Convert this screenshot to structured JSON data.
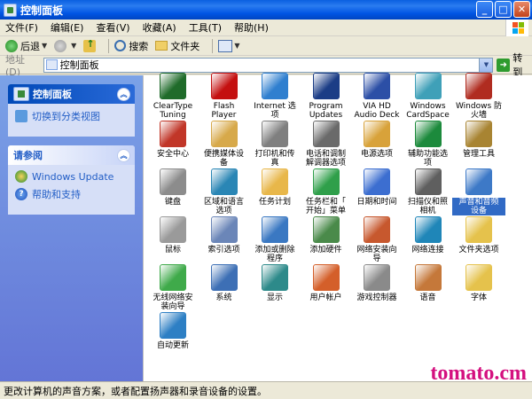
{
  "window": {
    "title": "控制面板"
  },
  "menu": [
    "文件(F)",
    "编辑(E)",
    "查看(V)",
    "收藏(A)",
    "工具(T)",
    "帮助(H)"
  ],
  "toolbar": {
    "back": "后退",
    "search": "搜索",
    "folders": "文件夹"
  },
  "address": {
    "label": "地址(D)",
    "value": "控制面板",
    "go": "转到"
  },
  "leftpane": {
    "panel1": {
      "title": "控制面板",
      "link": "切换到分类视图"
    },
    "panel2": {
      "title": "请参阅",
      "links": [
        "Windows Update",
        "帮助和支持"
      ]
    }
  },
  "items": [
    {
      "l1": "ClearType",
      "l2": "Tuning",
      "icon": "cleartype-icon",
      "color": "#1f6b2a"
    },
    {
      "l1": "Flash",
      "l2": "Player",
      "icon": "flash-icon",
      "color": "#c41010"
    },
    {
      "l1": "Internet 选",
      "l2": "项",
      "icon": "internet-options-icon",
      "color": "#2f7fcf"
    },
    {
      "l1": "Program",
      "l2": "Updates",
      "icon": "program-updates-icon",
      "color": "#1b3d86"
    },
    {
      "l1": "VIA HD",
      "l2": "Audio Deck",
      "icon": "via-audio-icon",
      "color": "#2c4fa6"
    },
    {
      "l1": "Windows",
      "l2": "CardSpace",
      "icon": "cardspace-icon",
      "color": "#3fa0b8"
    },
    {
      "l1": "Windows 防",
      "l2": "火墙",
      "icon": "firewall-icon",
      "color": "#b02c20"
    },
    {
      "l1": "安全中心",
      "l2": "",
      "icon": "security-center-icon",
      "color": "#c13628"
    },
    {
      "l1": "便携媒体设",
      "l2": "备",
      "icon": "portable-media-icon",
      "color": "#d7a94a"
    },
    {
      "l1": "打印机和传",
      "l2": "真",
      "icon": "printer-icon",
      "color": "#7f7f7f"
    },
    {
      "l1": "电话和调制",
      "l2": "解调器选项",
      "icon": "phone-modem-icon",
      "color": "#6a6a6a"
    },
    {
      "l1": "电源选项",
      "l2": "",
      "icon": "power-icon",
      "color": "#d8a23a"
    },
    {
      "l1": "辅助功能选",
      "l2": "项",
      "icon": "accessibility-icon",
      "color": "#1c8a3c"
    },
    {
      "l1": "管理工具",
      "l2": "",
      "icon": "admin-tools-icon",
      "color": "#a88432"
    },
    {
      "l1": "键盘",
      "l2": "",
      "icon": "keyboard-icon",
      "color": "#8c8c8c"
    },
    {
      "l1": "区域和语言",
      "l2": "选项",
      "icon": "region-language-icon",
      "color": "#2a86b5"
    },
    {
      "l1": "任务计划",
      "l2": "",
      "icon": "scheduled-tasks-icon",
      "color": "#e8b74a"
    },
    {
      "l1": "任务栏和「",
      "l2": "开始」菜单",
      "icon": "taskbar-icon",
      "color": "#2f9f4a"
    },
    {
      "l1": "日期和时间",
      "l2": "",
      "icon": "date-time-icon",
      "color": "#3c6ed0"
    },
    {
      "l1": "扫描仪和照",
      "l2": "相机",
      "icon": "scanner-camera-icon",
      "color": "#5f5f5f"
    },
    {
      "l1": "声音和音频",
      "l2": "设备",
      "icon": "sound-audio-icon",
      "color": "#3d79c7"
    },
    {
      "l1": "鼠标",
      "l2": "",
      "icon": "mouse-icon",
      "color": "#9a9a9a"
    },
    {
      "l1": "索引选项",
      "l2": "",
      "icon": "indexing-icon",
      "color": "#6b86b8"
    },
    {
      "l1": "添加或删除",
      "l2": "程序",
      "icon": "add-remove-programs-icon",
      "color": "#3a78c2"
    },
    {
      "l1": "添加硬件",
      "l2": "",
      "icon": "add-hardware-icon",
      "color": "#4a8a4a"
    },
    {
      "l1": "网络安装向",
      "l2": "导",
      "icon": "network-setup-icon",
      "color": "#c7582e"
    },
    {
      "l1": "网络连接",
      "l2": "",
      "icon": "network-connections-icon",
      "color": "#1f86b8"
    },
    {
      "l1": "文件夹选项",
      "l2": "",
      "icon": "folder-options-icon",
      "color": "#e5c24c"
    },
    {
      "l1": "无线网络安",
      "l2": "装向导",
      "icon": "wireless-setup-icon",
      "color": "#3faa4a"
    },
    {
      "l1": "系统",
      "l2": "",
      "icon": "system-icon",
      "color": "#3d6fb5"
    },
    {
      "l1": "显示",
      "l2": "",
      "icon": "display-icon",
      "color": "#2d8a8a"
    },
    {
      "l1": "用户帐户",
      "l2": "",
      "icon": "user-accounts-icon",
      "color": "#d45f2a"
    },
    {
      "l1": "游戏控制器",
      "l2": "",
      "icon": "game-controllers-icon",
      "color": "#8a8a8a"
    },
    {
      "l1": "语音",
      "l2": "",
      "icon": "speech-icon",
      "color": "#c5783a"
    },
    {
      "l1": "字体",
      "l2": "",
      "icon": "fonts-icon",
      "color": "#e5c24c"
    },
    {
      "l1": "自动更新",
      "l2": "",
      "icon": "auto-update-icon",
      "color": "#2d7fc4"
    }
  ],
  "selected_item": "声音和音频设备",
  "status": {
    "text": "更改计算机的声音方案，或者配置扬声器和录音设备的设置。"
  },
  "watermark": "tomato.cm"
}
